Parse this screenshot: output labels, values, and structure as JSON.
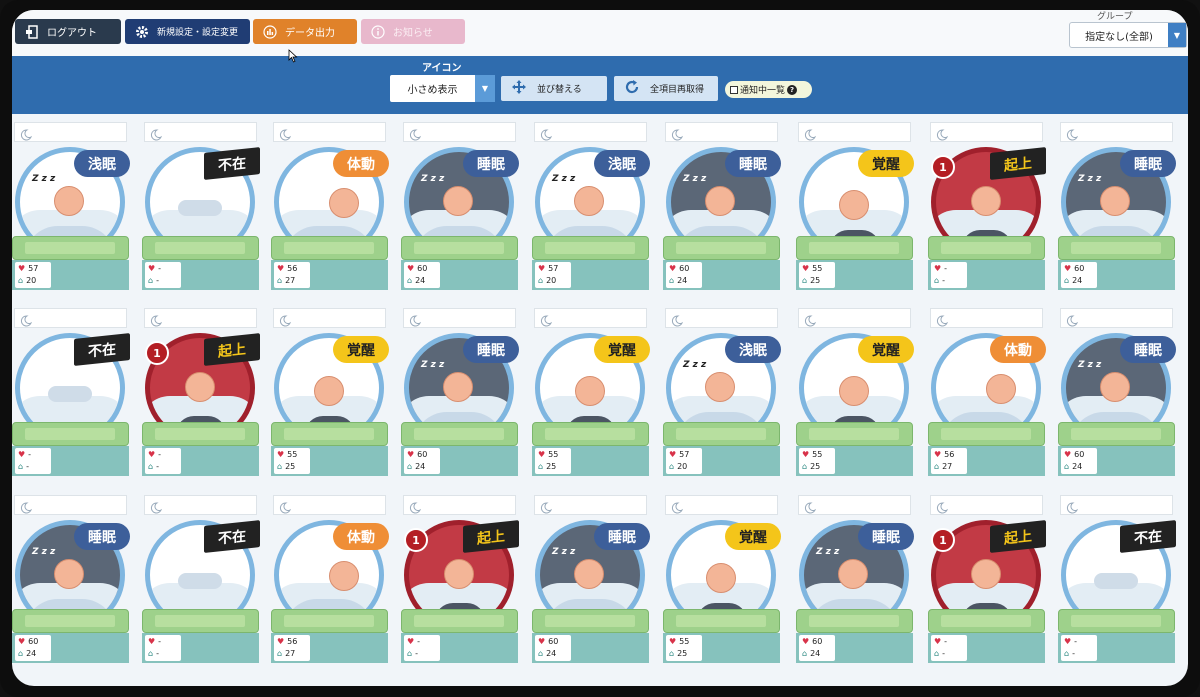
{
  "toolbar": {
    "logout_label": "ログアウト",
    "settings_label": "新規設定・設定変更",
    "export_label": "データ出力",
    "notice_label": "お知らせ"
  },
  "group": {
    "label": "グループ",
    "selected": "指定なし(全部)"
  },
  "bluebar": {
    "icon_label": "アイコン",
    "icon_select": "小さめ表示",
    "sort_label": "並び替える",
    "refresh_label": "全項目再取得",
    "notify_label": "通知中一覧"
  },
  "colors": {
    "accent": "#2f6cae",
    "logout": "#2a3a4d",
    "settings": "#203d74",
    "export": "#e0822a",
    "notice": "#e8b8cc"
  },
  "cards": [
    {
      "status": "浅眠",
      "type": "light",
      "hr": "57",
      "rr": "20"
    },
    {
      "status": "不在",
      "type": "out",
      "hr": "-",
      "rr": "-"
    },
    {
      "status": "体動",
      "type": "move",
      "hr": "56",
      "rr": "27"
    },
    {
      "status": "睡眠",
      "type": "deep",
      "hr": "60",
      "rr": "24"
    },
    {
      "status": "浅眠",
      "type": "light",
      "hr": "57",
      "rr": "20"
    },
    {
      "status": "睡眠",
      "type": "deep",
      "hr": "60",
      "rr": "24"
    },
    {
      "status": "覚醒",
      "type": "awake",
      "hr": "55",
      "rr": "25"
    },
    {
      "status": "起上",
      "type": "up",
      "hr": "-",
      "rr": "-",
      "alert": "1"
    },
    {
      "status": "睡眠",
      "type": "deep",
      "hr": "60",
      "rr": "24"
    },
    {
      "status": "不在",
      "type": "out",
      "hr": "-",
      "rr": "-"
    },
    {
      "status": "起上",
      "type": "up",
      "hr": "-",
      "rr": "-",
      "alert": "1"
    },
    {
      "status": "覚醒",
      "type": "awake",
      "hr": "55",
      "rr": "25"
    },
    {
      "status": "睡眠",
      "type": "deep",
      "hr": "60",
      "rr": "24"
    },
    {
      "status": "覚醒",
      "type": "awake",
      "hr": "55",
      "rr": "25"
    },
    {
      "status": "浅眠",
      "type": "light",
      "hr": "57",
      "rr": "20"
    },
    {
      "status": "覚醒",
      "type": "awake",
      "hr": "55",
      "rr": "25"
    },
    {
      "status": "体動",
      "type": "move",
      "hr": "56",
      "rr": "27"
    },
    {
      "status": "睡眠",
      "type": "deep",
      "hr": "60",
      "rr": "24"
    },
    {
      "status": "睡眠",
      "type": "deep",
      "hr": "60",
      "rr": "24"
    },
    {
      "status": "不在",
      "type": "out",
      "hr": "-",
      "rr": "-"
    },
    {
      "status": "体動",
      "type": "move",
      "hr": "56",
      "rr": "27"
    },
    {
      "status": "起上",
      "type": "up",
      "hr": "-",
      "rr": "-",
      "alert": "1"
    },
    {
      "status": "睡眠",
      "type": "deep",
      "hr": "60",
      "rr": "24"
    },
    {
      "status": "覚醒",
      "type": "awake",
      "hr": "55",
      "rr": "25"
    },
    {
      "status": "睡眠",
      "type": "deep",
      "hr": "60",
      "rr": "24"
    },
    {
      "status": "起上",
      "type": "up",
      "hr": "-",
      "rr": "-",
      "alert": "1"
    },
    {
      "status": "不在",
      "type": "out",
      "hr": "-",
      "rr": "-"
    }
  ]
}
